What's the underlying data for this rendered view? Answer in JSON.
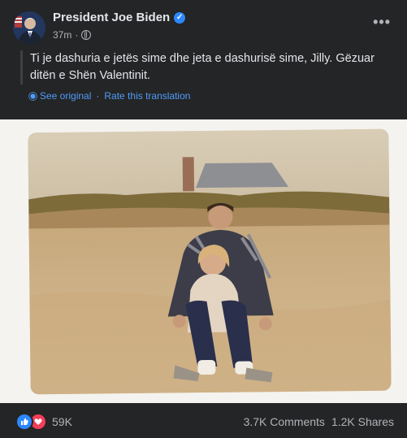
{
  "post": {
    "author": "President Joe Biden",
    "time": "37m",
    "text": "Ti je dashuria e jetës sime dhe jeta e dashurisë sime, Jilly. Gëzuar ditën e Shën Valentinit.",
    "see_original": "See original",
    "separator": "·",
    "rate_translation": "Rate this translation"
  },
  "icons": {
    "verified": "verified-badge-icon",
    "privacy": "globe-icon",
    "more": "more-options-icon",
    "translate_settings": "gear-icon",
    "like": "like-reaction-icon",
    "love": "love-reaction-icon"
  },
  "footer": {
    "reactions_count": "59K",
    "comments": "3.7K Comments",
    "shares": "1.2K Shares"
  },
  "colors": {
    "card_bg": "#242526",
    "link": "#4f9cf9",
    "verified": "#2d88ff",
    "like": "#2d88ff",
    "love": "#f33e58"
  }
}
